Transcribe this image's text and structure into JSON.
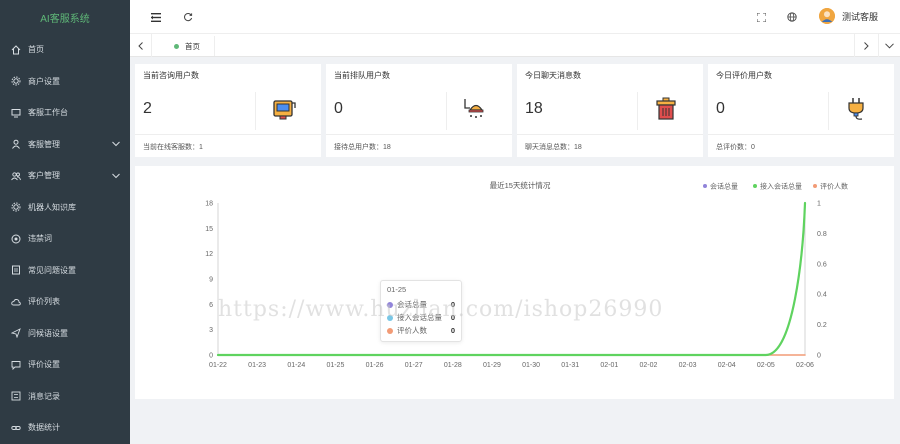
{
  "app": {
    "title": "AI客服系统"
  },
  "sidebar": {
    "items": [
      {
        "label": "首页",
        "icon": "home-icon",
        "arrow": false
      },
      {
        "label": "商户设置",
        "icon": "gear-icon",
        "arrow": false
      },
      {
        "label": "客服工作台",
        "icon": "monitor-icon",
        "arrow": false
      },
      {
        "label": "客服管理",
        "icon": "user-icon",
        "arrow": true
      },
      {
        "label": "客户管理",
        "icon": "users-icon",
        "arrow": true
      },
      {
        "label": "机器人知识库",
        "icon": "gear-icon",
        "arrow": false
      },
      {
        "label": "违禁词",
        "icon": "circle-icon",
        "arrow": false
      },
      {
        "label": "常见问题设置",
        "icon": "document-icon",
        "arrow": false
      },
      {
        "label": "评价列表",
        "icon": "cloud-icon",
        "arrow": false
      },
      {
        "label": "问候语设置",
        "icon": "send-icon",
        "arrow": false
      },
      {
        "label": "评价设置",
        "icon": "chat-icon",
        "arrow": false
      },
      {
        "label": "消息记录",
        "icon": "list-icon",
        "arrow": false
      },
      {
        "label": "数据统计",
        "icon": "link-icon",
        "arrow": false
      }
    ]
  },
  "header": {
    "user_name": "测试客服"
  },
  "tabs": [
    {
      "label": "首页",
      "active": true
    }
  ],
  "cards": [
    {
      "title": "当前咨询用户数",
      "value": "2",
      "footer": "当前在线客服数：1",
      "icon": "paint-bucket-icon"
    },
    {
      "title": "当前排队用户数",
      "value": "0",
      "footer": "接待总用户数：18",
      "icon": "shower-icon"
    },
    {
      "title": "今日聊天消息数",
      "value": "18",
      "footer": "聊天消息总数：18",
      "icon": "trash-icon"
    },
    {
      "title": "今日评价用户数",
      "value": "0",
      "footer": "总评价数：0",
      "icon": "plug-icon"
    }
  ],
  "watermark": "https://www.huzhan.com/ishop26990",
  "colors": {
    "sidebar": "#2f3b44",
    "accent": "#5fb878",
    "series1": "#9184d9",
    "series2": "#79c7e6",
    "series3": "#f29b76"
  },
  "chart_data": {
    "type": "line",
    "title": "最近15天统计情况",
    "categories": [
      "01-22",
      "01-23",
      "01-24",
      "01-25",
      "01-26",
      "01-27",
      "01-28",
      "01-29",
      "01-30",
      "01-31",
      "02-01",
      "02-02",
      "02-03",
      "02-04",
      "02-05",
      "02-06"
    ],
    "y_left": {
      "ticks": [
        0,
        3,
        6,
        9,
        12,
        15,
        18
      ],
      "range": [
        0,
        18
      ]
    },
    "y_right": {
      "ticks": [
        0,
        0.2,
        0.4,
        0.6,
        0.8,
        1
      ],
      "range": [
        0,
        1
      ]
    },
    "series": [
      {
        "name": "会话总量",
        "axis": "left",
        "color": "#9184d9",
        "values": [
          0,
          0,
          0,
          0,
          0,
          0,
          0,
          0,
          0,
          0,
          0,
          0,
          0,
          0,
          0,
          18
        ]
      },
      {
        "name": "接入会话总量",
        "axis": "left",
        "color": "#5fd35f",
        "values": [
          0,
          0,
          0,
          0,
          0,
          0,
          0,
          0,
          0,
          0,
          0,
          0,
          0,
          0,
          0,
          18
        ]
      },
      {
        "name": "评价人数",
        "axis": "right",
        "color": "#f29b76",
        "values": [
          0,
          0,
          0,
          0,
          0,
          0,
          0,
          0,
          0,
          0,
          0,
          0,
          0,
          0,
          0,
          0
        ]
      }
    ],
    "legend_position": "top-right",
    "tooltip": {
      "date": "01-25",
      "rows": [
        {
          "name": "会话总量",
          "value": "0",
          "color": "#9184d9"
        },
        {
          "name": "接入会话总量",
          "value": "0",
          "color": "#79c7e6"
        },
        {
          "name": "评价人数",
          "value": "0",
          "color": "#f29b76"
        }
      ]
    }
  }
}
